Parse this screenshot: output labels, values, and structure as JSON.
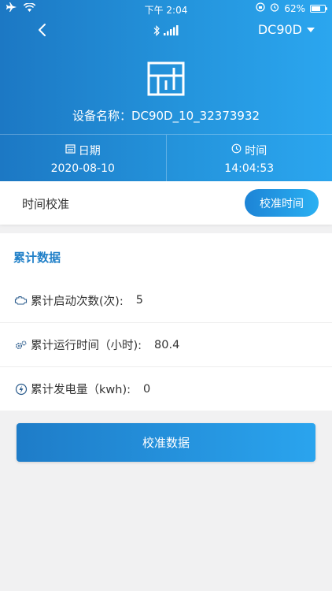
{
  "status_bar": {
    "time": "下午 2:04",
    "battery": "62%"
  },
  "nav": {
    "device": "DC90D"
  },
  "header": {
    "device_name": "设备名称：DC90D_10_32373932"
  },
  "datetime": {
    "date_label": "日期",
    "date_value": "2020-08-10",
    "time_label": "时间",
    "time_value": "14:04:53"
  },
  "calibration": {
    "label": "时间校准",
    "button": "校准时间"
  },
  "cumulative": {
    "title": "累计数据",
    "rows": [
      {
        "label": "累计启动次数(次):",
        "value": "5",
        "icon": "engine-icon"
      },
      {
        "label": "累计运行时间（小时):",
        "value": "80.4",
        "icon": "gears-icon"
      },
      {
        "label": "累计发电量（kwh):",
        "value": "0",
        "icon": "lightning-icon"
      }
    ]
  },
  "actions": {
    "calibrate_data": "校准数据"
  },
  "colors": {
    "primary": "#2494dc",
    "accent_text": "#2180c8",
    "background": "#f1f1f2"
  }
}
